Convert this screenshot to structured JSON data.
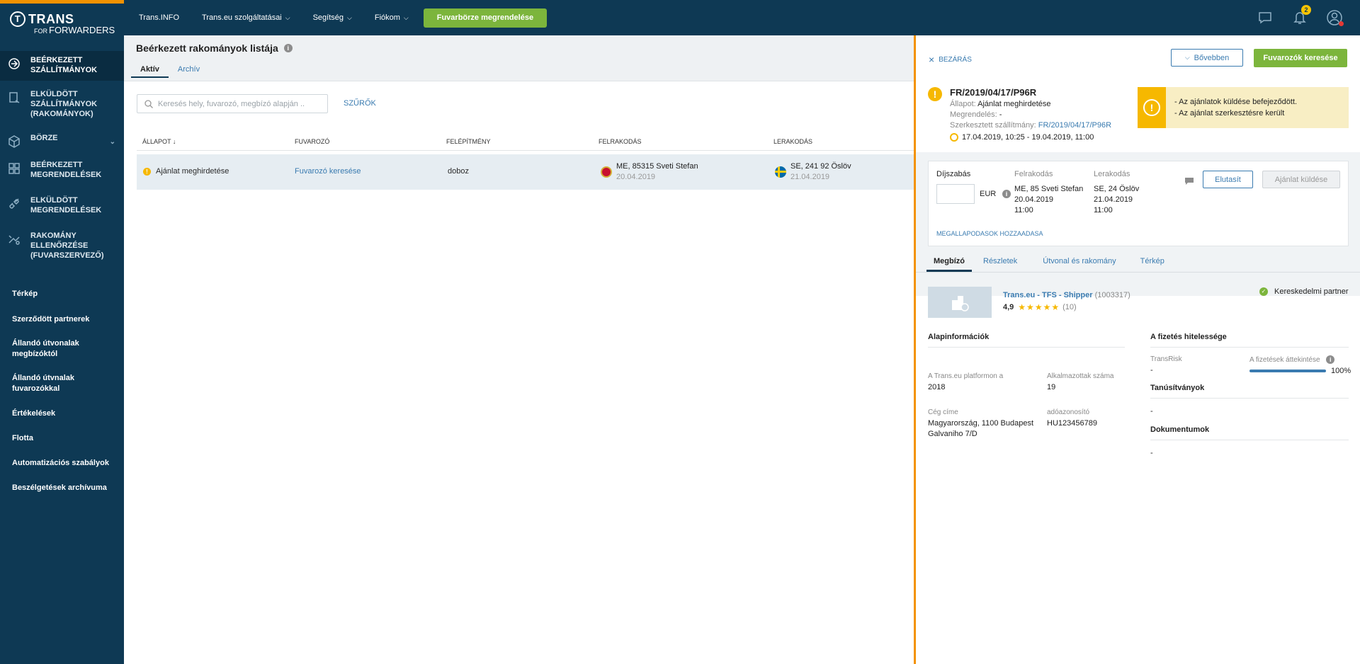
{
  "logo": {
    "line1": "TRANS",
    "line2_small": "FOR",
    "line2": "FORWARDERS"
  },
  "sidebar": {
    "main_items": [
      {
        "label": "BEÉRKEZETT SZÁLLÍTMÁNYOK",
        "icon": "incoming-shipments-icon"
      },
      {
        "label": "ELKÜLDÖTT SZÁLLÍTMÁNYOK (RAKOMÁNYOK)",
        "icon": "sent-shipments-icon"
      },
      {
        "label": "BÖRZE",
        "icon": "exchange-box-icon"
      },
      {
        "label": "BEÉRKEZETT MEGRENDELÉSEK",
        "icon": "incoming-orders-icon"
      },
      {
        "label": "ELKÜLDÖTT MEGRENDELÉSEK",
        "icon": "sent-orders-icon"
      },
      {
        "label": "RAKOMÁNY ELLENŐRZÉSE (FUVARSZERVEZŐ)",
        "icon": "load-check-icon"
      }
    ],
    "sub_items": [
      "Térkép",
      "Szerződött partnerek",
      "Állandó útvonalak megbízóktól",
      "Állandó útvnalak fuvarozókkal",
      "Értékelések",
      "Flotta",
      "Automatizációs szabályok",
      "Beszélgetések archívuma"
    ]
  },
  "topbar": {
    "links": [
      "Trans.INFO",
      "Trans.eu szolgáltatásai",
      "Segítség",
      "Fiókom"
    ],
    "order_button": "Fuvarbörze megrendelése",
    "notifications_count": "2"
  },
  "main": {
    "title": "Beérkezett rakományok listája",
    "tabs": [
      "Aktív",
      "Archív"
    ],
    "search_placeholder": "Keresés hely, fuvarozó, megbízó alapján ..",
    "filters": "SZŰRŐK",
    "columns": [
      "ÁLLAPOT ↓",
      "FUVAROZÓ",
      "FELÉPÍTMÉNY",
      "FELRAKODÁS",
      "LERAKODÁS"
    ],
    "row": {
      "status": "Ajánlat meghirdetése",
      "carrier": "Fuvarozó keresése",
      "body": "doboz",
      "loading_place": "ME, 85315 Sveti Stefan",
      "loading_date": "20.04.2019",
      "unloading_place": "SE, 241 92 Öslöv",
      "unloading_date": "21.04.2019"
    }
  },
  "panel": {
    "close": "BEZÁRÁS",
    "more": "Bővebben",
    "find_carriers": "Fuvarozók keresése",
    "shipment_id": "FR/2019/04/17/P96R",
    "status_label": "Állapot:",
    "status_value": "Ajánlat meghirdetése",
    "order_label": "Megrendelés:",
    "order_value": "-",
    "edited_label": "Szerkesztett szállítmány:",
    "edited_link": "FR/2019/04/17/P96R",
    "date_range": "17.04.2019, 10:25 - 19.04.2019, 11:00",
    "alert_lines": [
      "- Az ajánlatok küldése befejeződött.",
      "- Az ajánlat szerkesztésre került"
    ],
    "offer": {
      "price_label": "Díjszabás",
      "currency": "EUR",
      "loading_label": "Felrakodás",
      "loading_place": "ME, 85 Sveti Stefan",
      "loading_date": "20.04.2019",
      "loading_time": "11:00",
      "unloading_label": "Lerakodás",
      "unloading_place": "SE, 24 Öslöv",
      "unloading_date": "21.04.2019",
      "unloading_time": "11:00",
      "agreements_link": "MEGALLAPODASOK HOZZAADASA",
      "reject": "Elutasít",
      "send": "Ajánlat küldése"
    },
    "tabs": [
      "Megbízó",
      "Részletek",
      "Útvonal és rakomány",
      "Térkép"
    ],
    "company": {
      "name": "Trans.eu - TFS - Shipper",
      "id": "(1003317)",
      "rating": "4,9",
      "stars": "★★★★★",
      "reviews": "(10)",
      "partner": "Kereskedelmi partner"
    },
    "basic": {
      "title": "Alapinformációk",
      "platform_label": "A Trans.eu platformon a",
      "platform_value": "2018",
      "employees_label": "Alkalmazottak száma",
      "employees_value": "19",
      "address_label": "Cég címe",
      "address_line1": "Magyarország, 1100 Budapest",
      "address_line2": "Galvaniho 7/D",
      "tax_label": "adóazonosító",
      "tax_value": "HU123456789"
    },
    "payment": {
      "title": "A fizetés hitelessége",
      "transrisk_label": "TransRisk",
      "transrisk_value": "-",
      "overview_label": "A fizetések áttekintése",
      "overview_value": "100%",
      "overview_fraction": 1.0,
      "certs_title": "Tanúsítványok",
      "certs_value": "-",
      "docs_title": "Dokumentumok",
      "docs_value": "-"
    }
  },
  "colors": {
    "accent": "#7cb53c",
    "navy": "#0e3954",
    "orange": "#f39200",
    "warning": "#f6b800",
    "link": "#3a7bb0"
  }
}
